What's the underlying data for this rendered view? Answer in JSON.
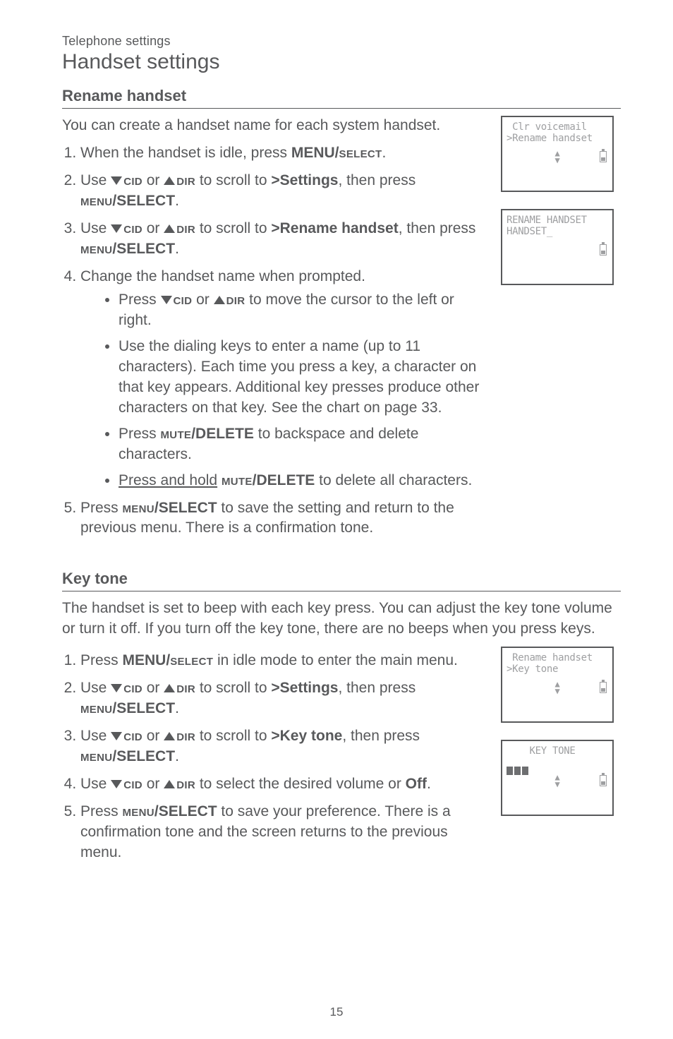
{
  "header": {
    "eyebrow": "Telephone settings",
    "title": "Handset settings"
  },
  "section1": {
    "heading": "Rename handset",
    "intro": "You can create a handset name for each system handset.",
    "steps": {
      "s1_a": "When the handset is idle, press ",
      "s1_b": "MENU/",
      "s1_c": "select",
      "s1_d": ".",
      "s2_a": "Use ",
      "s2_cid": "cid",
      "s2_or": " or ",
      "s2_dir": "dir",
      "s2_b": " to scroll to ",
      "s2_target": ">Settings",
      "s2_c": ", then press ",
      "s2_menu": "menu",
      "s2_sel": "/SELECT",
      "s2_d": ".",
      "s3_a": "Use ",
      "s3_b": " to scroll to ",
      "s3_target": ">Rename handset",
      "s3_c": ", then press ",
      "s3_d": ".",
      "s4": "Change the handset name when prompted.",
      "b1_a": "Press ",
      "b1_b": " to move the cursor to the left or right.",
      "b2": "Use the dialing keys to enter a name (up to 11 characters). Each time you press a key, a character on that key appears. Additional key presses produce other characters on that key. See the chart on page 33.",
      "b3_a": "Press ",
      "b3_mute": "mute",
      "b3_del": "/DELETE",
      "b3_b": " to backspace and delete characters.",
      "b4_a": "Press and hold",
      "b4_b": " to delete all characters.",
      "s5_a": "Press ",
      "s5_b": " to save the setting and return to the previous menu. There is a confirmation tone."
    }
  },
  "section2": {
    "heading": "Key tone",
    "intro": "The handset is set to beep with each key press. You can adjust the key tone volume or turn it off. If you turn off the key tone, there are no beeps when you press keys.",
    "steps": {
      "s1_a": "Press ",
      "s1_b": "MENU/",
      "s1_c": "select",
      "s1_d": " in idle mode to enter the main menu.",
      "s2_a": "Use ",
      "s2_b": " to scroll to ",
      "s2_target": ">Settings",
      "s2_c": ", then press ",
      "s2_d": ".",
      "s3_a": "Use ",
      "s3_b": " to scroll to ",
      "s3_target": ">Key tone",
      "s3_c": ", then press ",
      "s3_d": ".",
      "s4_a": "Use ",
      "s4_b": " to select the desired volume or ",
      "s4_off": "Off",
      "s4_c": ".",
      "s5_a": "Press ",
      "s5_b": " to save your preference. There is a confirmation tone and the screen returns to the previous menu."
    }
  },
  "screens": {
    "s1l1": " Clr voicemail",
    "s1l2": ">Rename handset",
    "s2l1": "RENAME HANDSET",
    "s2l2": "HANDSET_",
    "s3l1": " Rename handset",
    "s3l2": ">Key tone",
    "s4l1": "    KEY TONE"
  },
  "footer": {
    "pagenum": "15"
  }
}
